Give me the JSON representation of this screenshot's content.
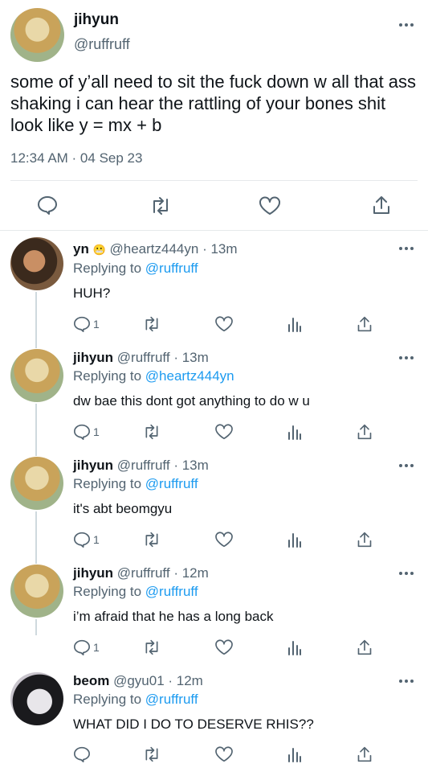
{
  "main": {
    "display_name": "jihyun",
    "handle": "@ruffruff",
    "text": "some of y’all need to sit the fuck down w all that ass shaking i can hear the rattling of your bones shit look like y = mx + b",
    "timestamp": "12:34 AM · 04 Sep 23"
  },
  "replies": [
    {
      "name": "yn",
      "emoji": "😬",
      "handle": "@heartz444yn",
      "time": "· 13m",
      "replying": "Replying to",
      "to": "@ruffruff",
      "text": "HUH?",
      "reply_count": "1"
    },
    {
      "name": "jihyun",
      "handle": "@ruffruff",
      "time": "· 13m",
      "replying": "Replying to",
      "to": "@heartz444yn",
      "text": "dw bae this dont got anything to do w u",
      "reply_count": "1"
    },
    {
      "name": "jihyun",
      "handle": "@ruffruff",
      "time": "· 13m",
      "replying": "Replying to",
      "to": "@ruffruff",
      "text": "it's abt beomgyu",
      "reply_count": "1"
    },
    {
      "name": "jihyun",
      "handle": "@ruffruff",
      "time": "· 12m",
      "replying": "Replying to",
      "to": "@ruffruff",
      "text": "i’m afraid that he has a long back",
      "reply_count": "1"
    },
    {
      "name": "beom",
      "handle": "@gyu01",
      "time": "· 12m",
      "replying": "Replying to",
      "to": "@ruffruff",
      "text": "WHAT DID I DO TO DESERVE RHIS??",
      "reply_count": ""
    }
  ],
  "colors": {
    "accent": "#1d9bf0",
    "muted": "#536471",
    "text": "#0f1419",
    "border": "#e6e9eb"
  },
  "icons": [
    "reply-icon",
    "retweet-icon",
    "like-icon",
    "analytics-icon",
    "share-icon",
    "more-icon"
  ]
}
